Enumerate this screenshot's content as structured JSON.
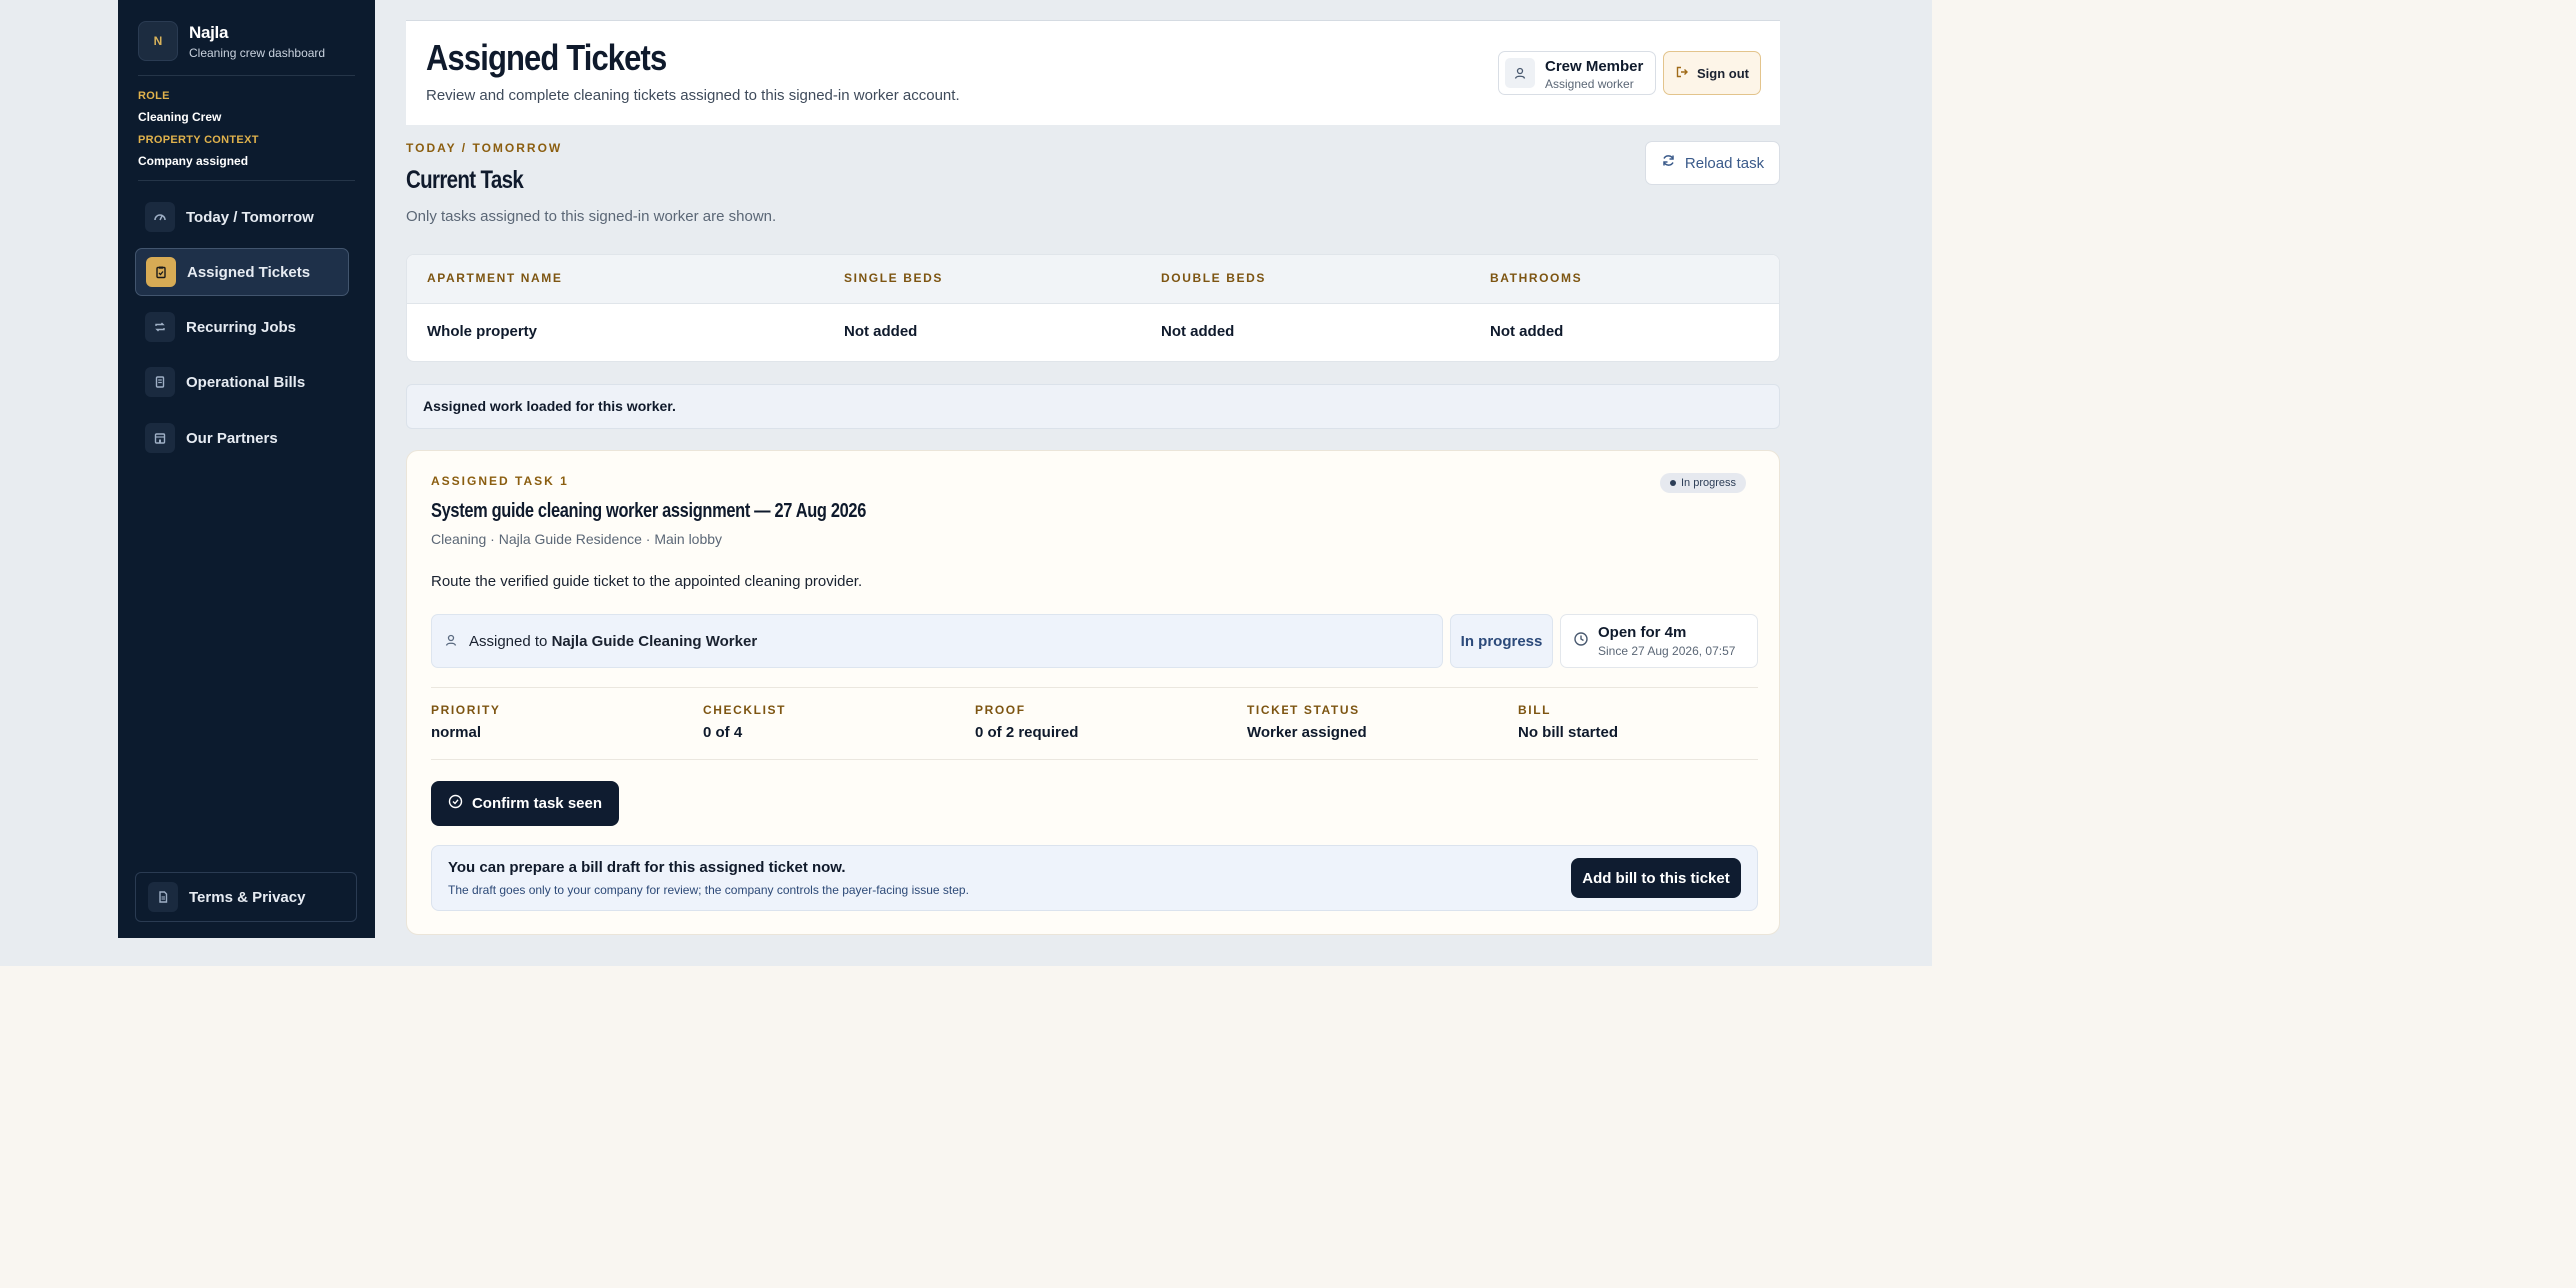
{
  "brand": {
    "logo_text": "N",
    "name": "Najla",
    "subtitle": "Cleaning crew dashboard"
  },
  "context": {
    "role_label": "ROLE",
    "role_value": "Cleaning Crew",
    "property_label": "PROPERTY CONTEXT",
    "property_value": "Company assigned"
  },
  "sidebar": {
    "items": [
      {
        "label": "Today / Tomorrow",
        "icon": "gauge-icon"
      },
      {
        "label": "Assigned Tickets",
        "icon": "clipboard-icon",
        "active": true
      },
      {
        "label": "Recurring Jobs",
        "icon": "repeat-icon"
      },
      {
        "label": "Operational Bills",
        "icon": "receipt-icon"
      },
      {
        "label": "Our Partners",
        "icon": "building-icon"
      }
    ],
    "terms_label": "Terms & Privacy"
  },
  "header": {
    "title": "Assigned Tickets",
    "subtitle": "Review and complete cleaning tickets assigned to this signed-in worker account.",
    "user_name": "Crew Member",
    "user_role": "Assigned worker",
    "signout_label": "Sign out"
  },
  "section": {
    "eyebrow": "TODAY / TOMORROW",
    "title": "Current Task",
    "subtitle": "Only tasks assigned to this signed-in worker are shown.",
    "reload_label": "Reload task"
  },
  "table": {
    "headers": [
      "APARTMENT NAME",
      "SINGLE BEDS",
      "DOUBLE BEDS",
      "BATHROOMS"
    ],
    "row": [
      "Whole property",
      "Not added",
      "Not added",
      "Not added"
    ]
  },
  "notice": "Assigned work loaded for this worker.",
  "task": {
    "eyebrow": "ASSIGNED TASK 1",
    "badge": "In progress",
    "title": "System guide cleaning worker assignment — 27 Aug 2026",
    "meta": "Cleaning · Najla Guide Residence · Main lobby",
    "description": "Route the verified guide ticket to the appointed cleaning provider.",
    "assigned_prefix": "Assigned to",
    "assigned_name": "Najla Guide Cleaning Worker",
    "status": "In progress",
    "open_main": "Open for 4m",
    "open_sub": "Since 27 Aug 2026, 07:57",
    "stats": [
      {
        "label": "PRIORITY",
        "value": "normal"
      },
      {
        "label": "CHECKLIST",
        "value": "0 of 4"
      },
      {
        "label": "PROOF",
        "value": "0 of 2 required"
      },
      {
        "label": "TICKET STATUS",
        "value": "Worker assigned"
      },
      {
        "label": "BILL",
        "value": "No bill started"
      }
    ],
    "confirm_label": "Confirm task seen",
    "bill_title": "You can prepare a bill draft for this assigned ticket now.",
    "bill_sub": "The draft goes only to your company for review; the company controls the payer-facing issue step.",
    "bill_button": "Add bill to this ticket"
  },
  "colors": {
    "sidebar": "#0c1b2e",
    "accent": "#d7ab55",
    "eyebrow": "#8b5e10",
    "primary_button": "#0f1c30"
  }
}
